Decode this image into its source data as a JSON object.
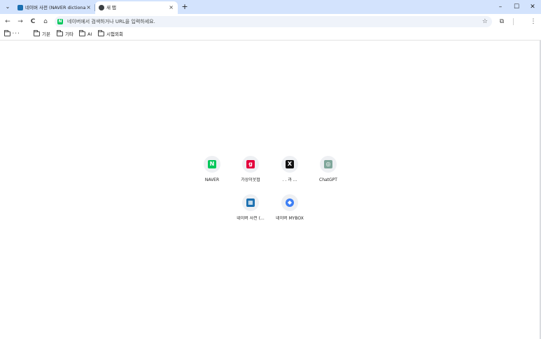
{
  "tabs": {
    "inactive_title": "네이버 사전 (NAVER dictionary",
    "active_title": "새 탭",
    "close_glyph": "×",
    "new_tab_glyph": "+"
  },
  "window": {
    "minimize": "–",
    "maximize": "☐",
    "close": "✕",
    "tab_search": "⌄"
  },
  "toolbar": {
    "back": "←",
    "forward": "→",
    "reload": "C",
    "home": "⌂",
    "omnibox_favicon": "N",
    "omnibox_placeholder": "네이버에서 검색하거나 URL을 입력하세요.",
    "star": "☆",
    "extensions": "⧉",
    "menu": "⋮"
  },
  "bookmarks": [
    {
      "label": "' ' '"
    },
    {
      "label": "기본"
    },
    {
      "label": "기타"
    },
    {
      "label": "AI"
    },
    {
      "label": "시험외회"
    }
  ],
  "shortcuts": [
    {
      "label": "NAVER",
      "icon": "naver-icon",
      "glyph": "N",
      "color": "#03c75a"
    },
    {
      "label": "가상이웃협",
      "icon": "gasang-icon",
      "glyph": "g",
      "color": "#e4003c"
    },
    {
      "label": ". . 과 ...",
      "icon": "x-icon",
      "glyph": "X",
      "color": "#111111"
    },
    {
      "label": "ChatGPT",
      "icon": "chatgpt-icon",
      "glyph": "◎",
      "color": "#7fa69a"
    },
    {
      "label": "네이버 사전 (...",
      "icon": "naver-dictionary-icon",
      "glyph": "▦",
      "color": "#1a6fb0"
    },
    {
      "label": "네이버 MYBOX",
      "icon": "mybox-icon",
      "glyph": "◆",
      "color": "#3d7ff5"
    }
  ]
}
